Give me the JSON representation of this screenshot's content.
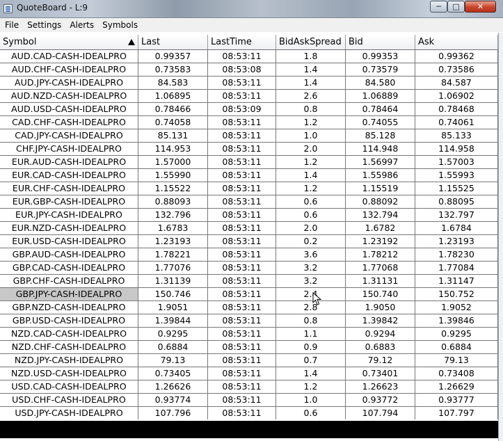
{
  "window": {
    "title": "QuoteBoard - L:9",
    "buttons": {
      "minimize": "─",
      "maximize": "□",
      "close": "✕"
    }
  },
  "menu": [
    "File",
    "Settings",
    "Alerts",
    "Symbols"
  ],
  "table": {
    "columns": [
      "Symbol",
      "Last",
      "LastTime",
      "BidAskSpread",
      "Bid",
      "Ask"
    ],
    "sorted_column": "Symbol",
    "sort_direction": "ascending",
    "selected_row": 18,
    "rows": [
      [
        "AUD.CAD-CASH-IDEALPRO",
        "0.99357",
        "08:53:11",
        "1.8",
        "0.99353",
        "0.99362"
      ],
      [
        "AUD.CHF-CASH-IDEALPRO",
        "0.73583",
        "08:53:08",
        "1.4",
        "0.73579",
        "0.73586"
      ],
      [
        "AUD.JPY-CASH-IDEALPRO",
        "84.583",
        "08:53:11",
        "1.4",
        "84.580",
        "84.587"
      ],
      [
        "AUD.NZD-CASH-IDEALPRO",
        "1.06895",
        "08:53:11",
        "2.6",
        "1.06889",
        "1.06902"
      ],
      [
        "AUD.USD-CASH-IDEALPRO",
        "0.78466",
        "08:53:09",
        "0.8",
        "0.78464",
        "0.78468"
      ],
      [
        "CAD.CHF-CASH-IDEALPRO",
        "0.74058",
        "08:53:11",
        "1.2",
        "0.74055",
        "0.74061"
      ],
      [
        "CAD.JPY-CASH-IDEALPRO",
        "85.131",
        "08:53:11",
        "1.0",
        "85.128",
        "85.133"
      ],
      [
        "CHF.JPY-CASH-IDEALPRO",
        "114.953",
        "08:53:11",
        "2.0",
        "114.948",
        "114.958"
      ],
      [
        "EUR.AUD-CASH-IDEALPRO",
        "1.57000",
        "08:53:11",
        "1.2",
        "1.56997",
        "1.57003"
      ],
      [
        "EUR.CAD-CASH-IDEALPRO",
        "1.55990",
        "08:53:11",
        "1.4",
        "1.55986",
        "1.55993"
      ],
      [
        "EUR.CHF-CASH-IDEALPRO",
        "1.15522",
        "08:53:11",
        "1.2",
        "1.15519",
        "1.15525"
      ],
      [
        "EUR.GBP-CASH-IDEALPRO",
        "0.88093",
        "08:53:11",
        "0.6",
        "0.88092",
        "0.88095"
      ],
      [
        "EUR.JPY-CASH-IDEALPRO",
        "132.796",
        "08:53:11",
        "0.6",
        "132.794",
        "132.797"
      ],
      [
        "EUR.NZD-CASH-IDEALPRO",
        "1.6783",
        "08:53:11",
        "2.0",
        "1.6782",
        "1.6784"
      ],
      [
        "EUR.USD-CASH-IDEALPRO",
        "1.23193",
        "08:53:11",
        "0.2",
        "1.23192",
        "1.23193"
      ],
      [
        "GBP.AUD-CASH-IDEALPRO",
        "1.78221",
        "08:53:11",
        "3.6",
        "1.78212",
        "1.78230"
      ],
      [
        "GBP.CAD-CASH-IDEALPRO",
        "1.77076",
        "08:53:11",
        "3.2",
        "1.77068",
        "1.77084"
      ],
      [
        "GBP.CHF-CASH-IDEALPRO",
        "1.31139",
        "08:53:11",
        "3.2",
        "1.31131",
        "1.31147"
      ],
      [
        "GBP.JPY-CASH-IDEALPRO",
        "150.746",
        "08:53:11",
        "2.4",
        "150.740",
        "150.752"
      ],
      [
        "GBP.NZD-CASH-IDEALPRO",
        "1.9051",
        "08:53:11",
        "2.8",
        "1.9050",
        "1.9052"
      ],
      [
        "GBP.USD-CASH-IDEALPRO",
        "1.39844",
        "08:53:11",
        "0.8",
        "1.39842",
        "1.39846"
      ],
      [
        "NZD.CAD-CASH-IDEALPRO",
        "0.9295",
        "08:53:11",
        "1.1",
        "0.9294",
        "0.9295"
      ],
      [
        "NZD.CHF-CASH-IDEALPRO",
        "0.6884",
        "08:53:11",
        "0.9",
        "0.6883",
        "0.6884"
      ],
      [
        "NZD.JPY-CASH-IDEALPRO",
        "79.13",
        "08:53:11",
        "0.7",
        "79.12",
        "79.13"
      ],
      [
        "NZD.USD-CASH-IDEALPRO",
        "0.73405",
        "08:53:11",
        "1.4",
        "0.73401",
        "0.73408"
      ],
      [
        "USD.CAD-CASH-IDEALPRO",
        "1.26626",
        "08:53:11",
        "1.2",
        "1.26623",
        "1.26629"
      ],
      [
        "USD.CHF-CASH-IDEALPRO",
        "0.93774",
        "08:53:11",
        "1.0",
        "0.93772",
        "0.93777"
      ],
      [
        "USD.JPY-CASH-IDEALPRO",
        "107.796",
        "08:53:11",
        "0.6",
        "107.794",
        "107.797"
      ]
    ]
  }
}
